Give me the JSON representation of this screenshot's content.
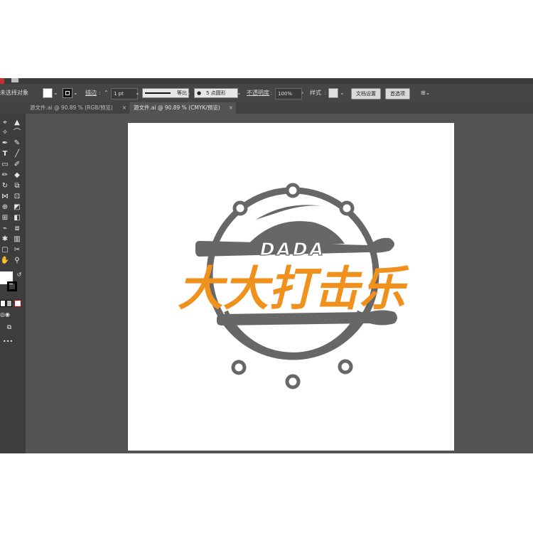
{
  "control_bar": {
    "selection_label": "未选择对象",
    "stroke_label": "描边",
    "stroke_value": "1 pt",
    "profile_label": "等比",
    "brush_label": "5 点圆形",
    "opacity_label": "不透明度",
    "opacity_value": "100%",
    "style_label": "样式",
    "doc_setup_button": "文档设置",
    "prefs_button": "首选项"
  },
  "tabs": [
    {
      "label": "源文件.ai @ 90.89 % (RGB/预览)",
      "close": "×",
      "active": false
    },
    {
      "label": "源文件.ai @ 90.89 % (CMYK/预览)",
      "close": "×",
      "active": true
    }
  ],
  "tools": {
    "icons": [
      "selection-icon",
      "direct-selection-icon",
      "magic-wand-icon",
      "lasso-icon",
      "pen-icon",
      "curvature-icon",
      "type-icon",
      "line-icon",
      "rectangle-icon",
      "paintbrush-icon",
      "shaper-icon",
      "eraser-icon",
      "rotate-icon",
      "scale-icon",
      "width-icon",
      "free-transform-icon",
      "shape-builder-icon",
      "perspective-icon",
      "mesh-icon",
      "gradient-icon",
      "eyedropper-icon",
      "blend-icon",
      "symbol-sprayer-icon",
      "graph-icon",
      "artboard-icon",
      "slice-icon",
      "hand-icon",
      "zoom-icon"
    ],
    "more_label": "•••"
  },
  "logo": {
    "wordmark": "DADA",
    "title": "大大打击乐",
    "colors": {
      "gray": "#676767",
      "orange": "#f0911e"
    }
  },
  "colors": {
    "app_bg": "#535353",
    "panel_bg": "#454545",
    "toolbar_bg": "#3d3d3d"
  }
}
